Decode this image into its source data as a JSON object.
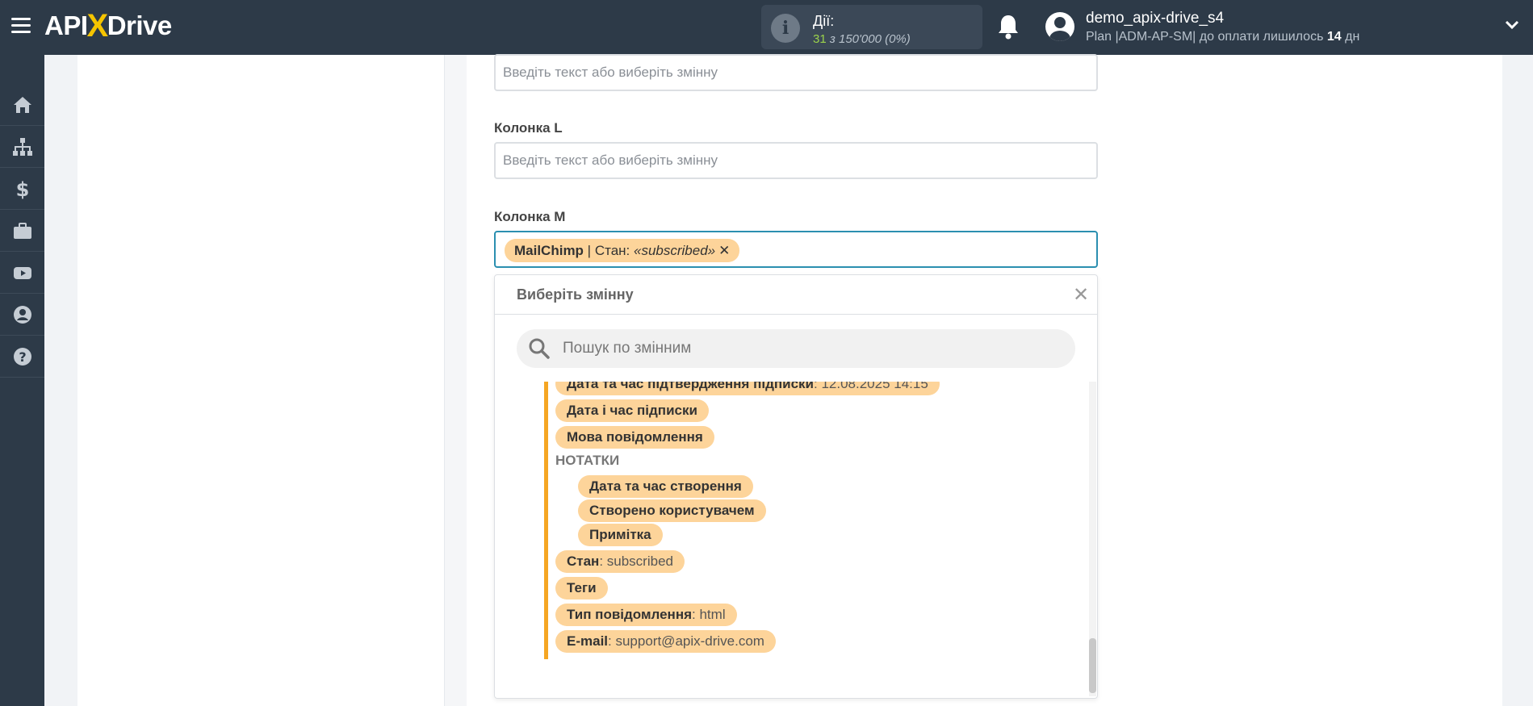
{
  "header": {
    "logo_left": "API",
    "logo_x": "X",
    "logo_right": "Drive",
    "actions_label": "Дії:",
    "actions_count": "31",
    "actions_of": "з 150'000",
    "actions_percent": "(0%)",
    "user_name": "demo_apix-drive_s4",
    "plan_text": "Plan |ADM-AP-SM| до оплати лишилось",
    "plan_days": "14",
    "plan_days_unit": "дн"
  },
  "sidebar": {
    "items": [
      "home-icon",
      "sitemap-icon",
      "dollar-icon",
      "briefcase-icon",
      "youtube-icon",
      "user-icon",
      "help-icon"
    ]
  },
  "form": {
    "top_placeholder": "Введіть текст або виберіть змінну",
    "col_l_label": "Колонка L",
    "col_l_placeholder": "Введіть текст або виберіть змінну",
    "col_m_label": "Колонка M",
    "selected": {
      "source": "MailChimp",
      "sep": " | Стан: ",
      "value": "«subscribed»",
      "remove": "✕"
    }
  },
  "dropdown": {
    "title": "Виберіть змінну",
    "close": "✕",
    "search_placeholder": "Пошук по змінним",
    "items": [
      {
        "label": "Дата та час підтвердження підписки",
        "value": ": 12.08.2025 14:15"
      },
      {
        "label": "Дата і час підписки",
        "value": ""
      },
      {
        "label": "Мова повідомлення",
        "value": ""
      },
      {
        "group": "НОТАТКИ"
      },
      {
        "label": "Дата та час створення",
        "value": ""
      },
      {
        "label": "Створено користувачем",
        "value": ""
      },
      {
        "label": "Примітка",
        "value": ""
      },
      {
        "label": "Стан",
        "value": ": subscribed"
      },
      {
        "label": "Теги",
        "value": ""
      },
      {
        "label": "Тип повідомлення",
        "value": ": html"
      },
      {
        "label": "E-mail",
        "value": ": support@apix-drive.com"
      }
    ]
  },
  "colors": {
    "topbar": "#2d3a48",
    "accent_yellow": "#f5c400",
    "chip_bg": "#fdd49a",
    "tree_line": "#f5a623",
    "active_border": "#2b8fb0",
    "actions_green": "#9bd24b"
  }
}
